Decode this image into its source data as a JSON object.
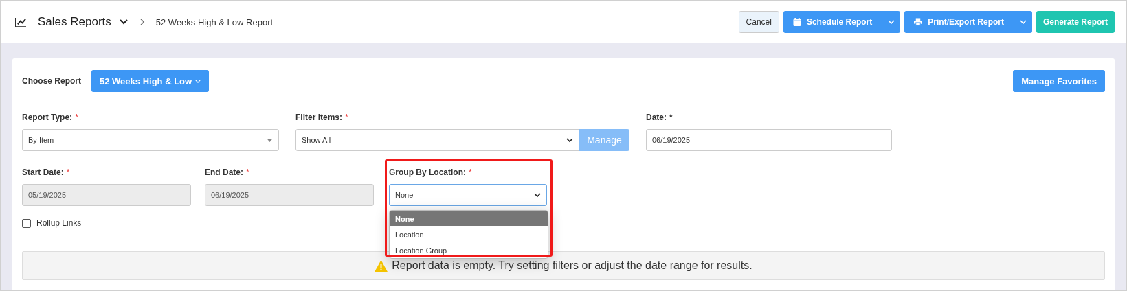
{
  "header": {
    "section": "Sales Reports",
    "breadcrumb": "52 Weeks High & Low Report",
    "buttons": [
      {
        "label": "Cancel",
        "kind": "plain"
      },
      {
        "label": "Schedule Report",
        "kind": "calendar-split"
      },
      {
        "label": "Print/Export Report",
        "kind": "print-split"
      },
      {
        "label": "Generate Report",
        "kind": "primary"
      }
    ]
  },
  "choose_report": {
    "label": "Choose Report",
    "value": "52 Weeks High & Low",
    "manage_favorites": "Manage Favorites"
  },
  "report_type": {
    "label": "Report Type:",
    "required_mark": "*",
    "value": "By Item"
  },
  "filter_items": {
    "label": "Filter Items:",
    "required_mark": "*",
    "value": "Show All",
    "manage": "Manage"
  },
  "date": {
    "label": "Date:",
    "required_mark": "*",
    "value": "06/19/2025"
  },
  "start_date": {
    "label": "Start Date:",
    "required_mark": "*",
    "value": "05/19/2025",
    "disabled": true
  },
  "end_date": {
    "label": "End Date:",
    "required_mark": "*",
    "value": "06/19/2025",
    "disabled": true
  },
  "group_by_location": {
    "label": "Group By Location:",
    "required_mark": "*",
    "value": "None",
    "expanded": true,
    "options": [
      {
        "label": "None",
        "selected": true
      },
      {
        "label": "Location",
        "selected": false
      },
      {
        "label": "Location Group",
        "selected": false
      }
    ]
  },
  "rollup_links": {
    "label": "Rollup Links",
    "checked": false
  },
  "alert": "Report data is empty. Try setting filters or adjust the date range for results."
}
